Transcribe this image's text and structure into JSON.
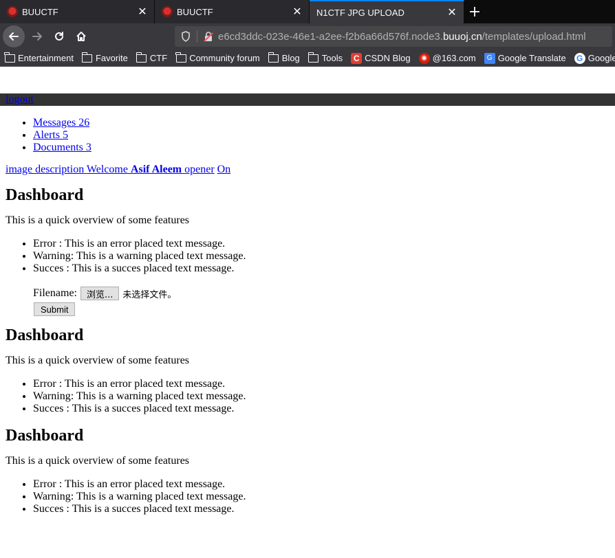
{
  "browser": {
    "tabs": [
      {
        "title": "BUUCTF",
        "active": false
      },
      {
        "title": "BUUCTF",
        "active": false
      },
      {
        "title": "N1CTF JPG UPLOAD",
        "active": true
      }
    ],
    "url": {
      "prefix": "e6cd3ddc-023e-46e1-a2ee-f2b6a66d576f.node3.",
      "domain": "buuoj.cn",
      "path": "/templates/upload.html"
    },
    "bookmarks": [
      {
        "label": "Entertainment",
        "icon": "folder-icon"
      },
      {
        "label": "Favorite",
        "icon": "folder-icon"
      },
      {
        "label": "CTF",
        "icon": "folder-icon"
      },
      {
        "label": "Community forum",
        "icon": "folder-icon"
      },
      {
        "label": "Blog",
        "icon": "folder-icon"
      },
      {
        "label": "Tools",
        "icon": "folder-icon"
      },
      {
        "label": "CSDN Blog",
        "icon": "csdn-icon"
      },
      {
        "label": "@163.com",
        "icon": "netease-icon"
      },
      {
        "label": "Google Translate",
        "icon": "google-translate-icon"
      },
      {
        "label": "Google",
        "icon": "google-icon"
      }
    ]
  },
  "page": {
    "logout": "logout",
    "nav": [
      {
        "label": "Messages 26"
      },
      {
        "label": "Alerts 5"
      },
      {
        "label": "Documents 3"
      }
    ],
    "user": {
      "image_alt": "image description",
      "welcome": "Welcome",
      "name": "Asif Aleem",
      "opener": "opener",
      "on": "On"
    },
    "sections": [
      {
        "heading": "Dashboard",
        "intro": "This is a quick overview of some features",
        "messages": [
          "Error : This is an error placed text message.",
          "Warning: This is a warning placed text message.",
          "Succes : This is a succes placed text message."
        ]
      },
      {
        "heading": "Dashboard",
        "intro": "This is a quick overview of some features",
        "messages": [
          "Error : This is an error placed text message.",
          "Warning: This is a warning placed text message.",
          "Succes : This is a succes placed text message."
        ]
      },
      {
        "heading": "Dashboard",
        "intro": "This is a quick overview of some features",
        "messages": [
          "Error : This is an error placed text message.",
          "Warning: This is a warning placed text message.",
          "Succes : This is a succes placed text message."
        ]
      }
    ],
    "upload": {
      "filename_label": "Filename:",
      "browse_label": "浏览...",
      "no_file_text": "未选择文件。",
      "submit_label": "Submit"
    }
  }
}
